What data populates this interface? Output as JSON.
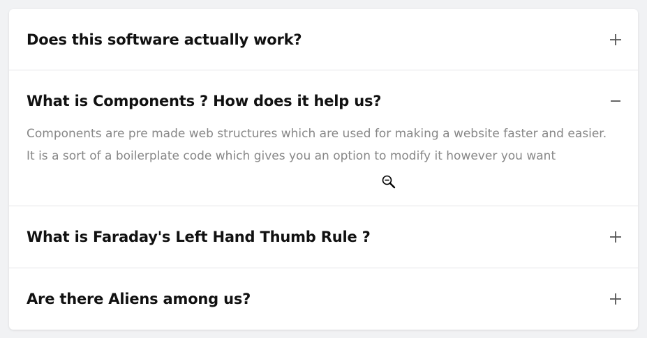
{
  "faq": {
    "items": [
      {
        "question": "Does this software actually work?",
        "expanded": false,
        "icon": "plus-icon"
      },
      {
        "question": "What is Components ? How does it help us?",
        "expanded": true,
        "icon": "minus-icon",
        "answer": "Components are pre made web structures which are used for making a website faster and easier. It is a sort of a boilerplate code which gives you an option to modify it however you want"
      },
      {
        "question": "What is Faraday's Left Hand Thumb Rule ?",
        "expanded": false,
        "icon": "plus-icon"
      },
      {
        "question": "Are there Aliens among us?",
        "expanded": false,
        "icon": "plus-icon"
      }
    ]
  },
  "colors": {
    "page_background": "#f1f2f4",
    "card_background": "#ffffff",
    "question_text": "#111111",
    "answer_text": "#878787",
    "divider": "#e3e4e7",
    "icon": "#555555"
  },
  "cursor": {
    "icon": "zoom-out-cursor-icon"
  }
}
